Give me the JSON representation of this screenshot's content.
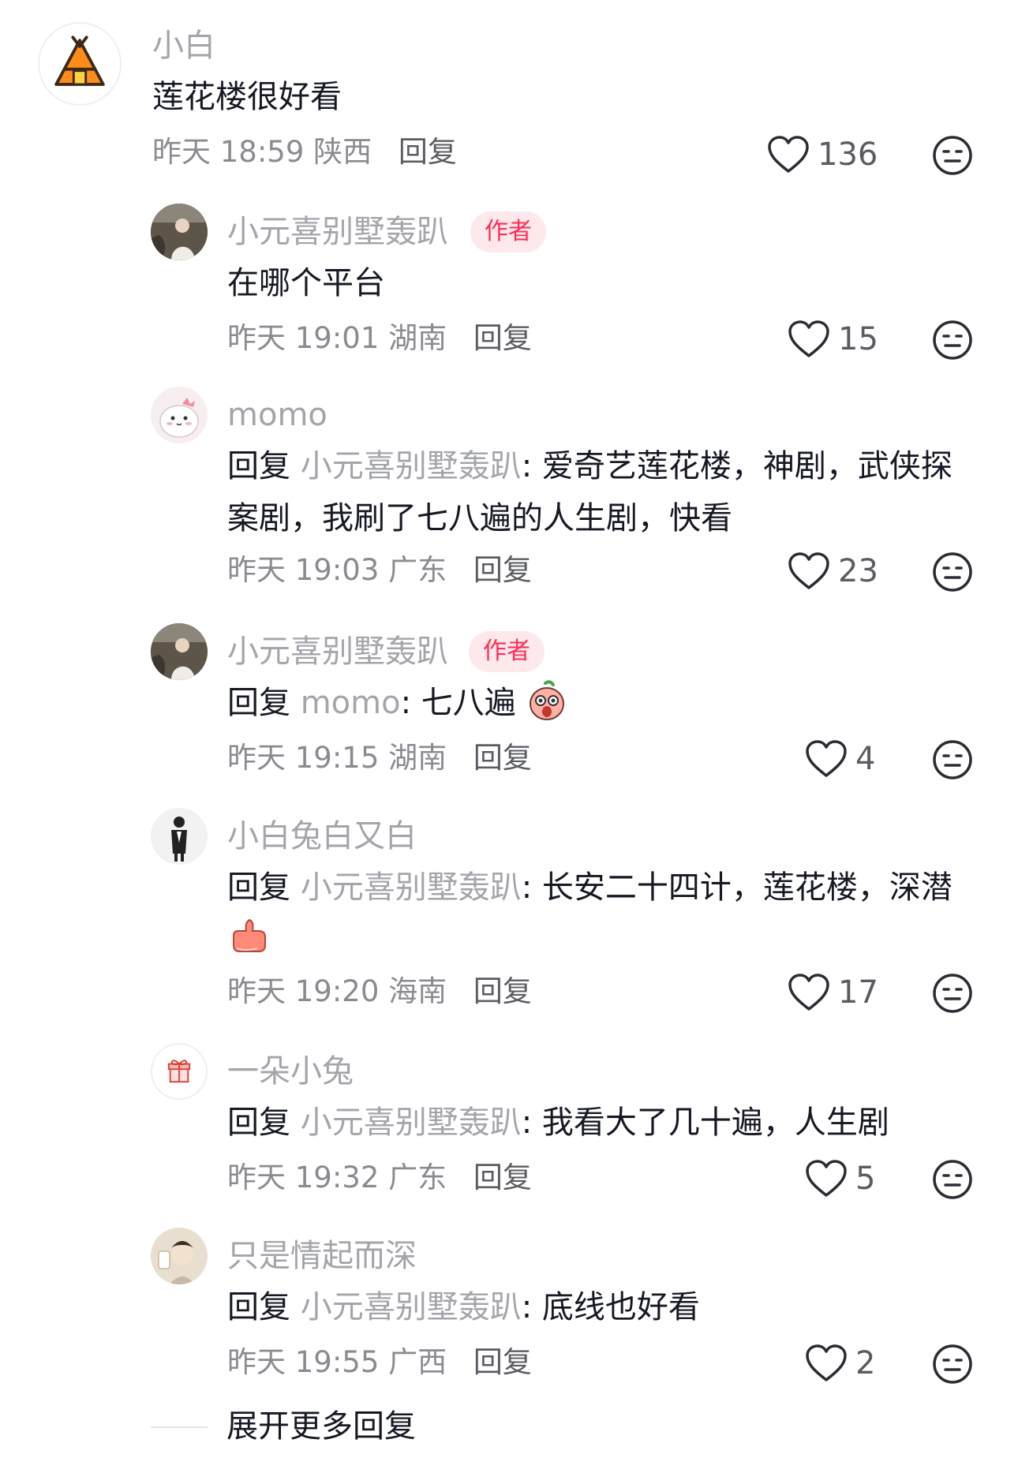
{
  "thread": {
    "top_comment": {
      "username": "小白",
      "text": "莲花楼很好看",
      "time": "昨天 18:59",
      "location": "陕西",
      "reply_label": "回复",
      "likes": "136"
    },
    "replies": [
      {
        "username": "小元喜别墅轰趴",
        "badge": "作者",
        "text": "在哪个平台",
        "time": "昨天 19:01",
        "location": "湖南",
        "reply_label": "回复",
        "likes": "15"
      },
      {
        "username": "momo",
        "reply_prefix": "回复",
        "reply_to": "小元喜别墅轰趴",
        "text_line1": ": 爱奇艺莲花楼，神剧，武侠探",
        "text_line2": "案剧，我刷了七八遍的人生剧，快看",
        "time": "昨天 19:03",
        "location": "广东",
        "reply_label": "回复",
        "likes": "23"
      },
      {
        "username": "小元喜别墅轰趴",
        "badge": "作者",
        "reply_prefix": "回复",
        "reply_to": "momo",
        "text_line1": ": 七八遍",
        "emoji": "shocked-face-emoji",
        "time": "昨天 19:15",
        "location": "湖南",
        "reply_label": "回复",
        "likes": "4"
      },
      {
        "username": "小白兔白又白",
        "reply_prefix": "回复",
        "reply_to": "小元喜别墅轰趴",
        "text_line1": ": 长安二十四计，莲花楼，深潜",
        "emoji": "thumbs-up-emoji",
        "time": "昨天 19:20",
        "location": "海南",
        "reply_label": "回复",
        "likes": "17"
      },
      {
        "username": "一朵小兔",
        "reply_prefix": "回复",
        "reply_to": "小元喜别墅轰趴",
        "text_line1": ": 我看大了几十遍，人生剧",
        "time": "昨天 19:32",
        "location": "广东",
        "reply_label": "回复",
        "likes": "5"
      },
      {
        "username": "只是情起而深",
        "reply_prefix": "回复",
        "reply_to": "小元喜别墅轰趴",
        "text_line1": ": 底线也好看",
        "time": "昨天 19:55",
        "location": "广西",
        "reply_label": "回复",
        "likes": "2"
      }
    ],
    "expand_label": "展开更多回复"
  },
  "colors": {
    "username": "#a3a5ab",
    "text": "#161823",
    "meta": "#8a8b91",
    "author_badge_bg": "#fde9ec",
    "author_badge_text": "#fe2c55"
  },
  "icons": {
    "like": "heart-outline-icon",
    "dislike": "neutral-face-icon",
    "top_avatar": "tent-icon"
  }
}
